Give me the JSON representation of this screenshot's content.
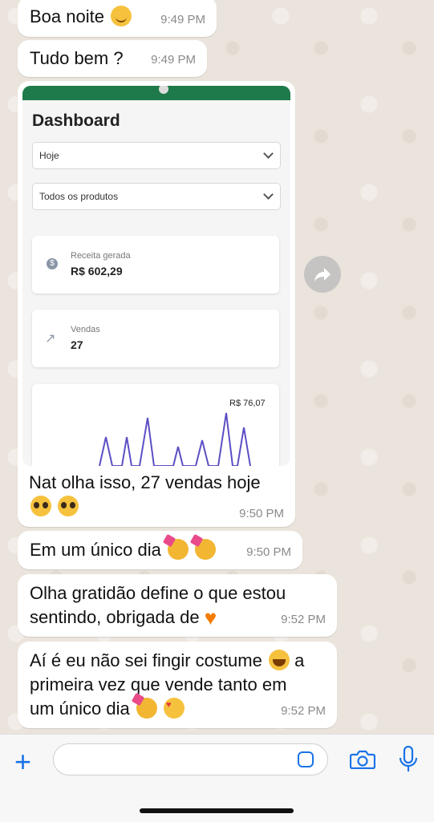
{
  "messages": [
    {
      "text": "Boa noite",
      "emoji": "smiling-face",
      "time": "9:49 PM"
    },
    {
      "text": "Tudo bem ?",
      "time": "9:49 PM"
    }
  ],
  "image_message": {
    "screenshot": {
      "title": "Dashboard",
      "select_period": "Hoje",
      "select_products": "Todos os produtos",
      "card_revenue_label": "Receita gerada",
      "card_revenue_value": "R$ 602,29",
      "card_sales_label": "Vendas",
      "card_sales_value": "27",
      "chart_label": "R$ 76,07"
    },
    "caption_line1": "Nat olha isso, 27 vendas hoje",
    "caption_emojis": "pleading-face pleading-face",
    "time": "9:50 PM"
  },
  "messages_after": [
    {
      "text": "Em um único dia",
      "emojis": "partying-face partying-face",
      "time": "9:50 PM"
    },
    {
      "line1": "Olha gratidão define o que estou",
      "line2": "sentindo, obrigada de",
      "emoji": "orange-heart",
      "time": "9:52 PM"
    },
    {
      "line1": "Aí é eu não sei fingir costume",
      "emoji1": "grinning-squinting-face",
      "line1b": "a",
      "line2": "primeira vez que vende tanto em",
      "line3": "um único dia",
      "emoji2": "partying-face heart-eyes-face",
      "time": "9:52 PM"
    }
  ],
  "input": {
    "placeholder": ""
  },
  "colors": {
    "accent": "#1a73e8",
    "bubble": "#ffffff",
    "time": "#8a8a8a",
    "dashboard_header": "#1e7a4a"
  }
}
